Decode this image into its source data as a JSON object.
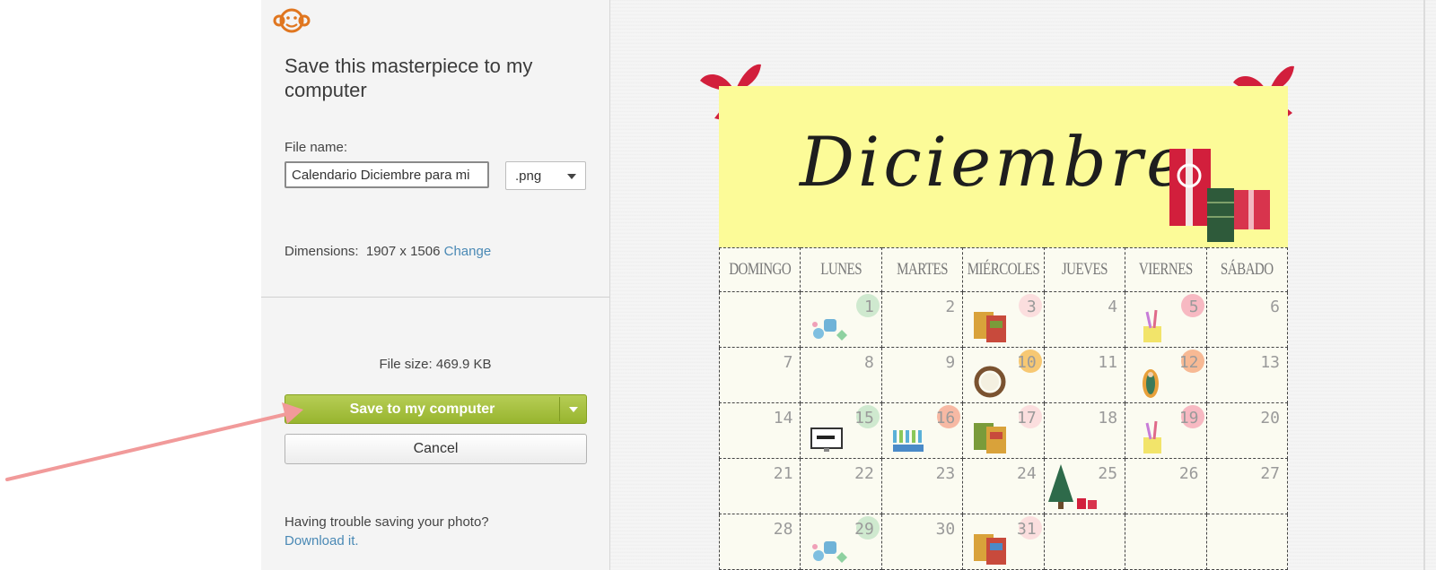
{
  "dialog": {
    "title": "Save this masterpiece to my computer",
    "file_name_label": "File name:",
    "file_name_value": "Calendario Diciembre para mi",
    "extension": ".png",
    "dimensions_label": "Dimensions:",
    "dimensions_value": "1907 x 1506",
    "change_link": "Change",
    "file_size": "File size: 469.9 KB",
    "save_button": "Save to my computer",
    "cancel_button": "Cancel",
    "trouble_text": "Having trouble saving your photo?",
    "download_link": "Download it."
  },
  "calendar": {
    "month": "Diciembre",
    "weekdays": [
      "DOMINGO",
      "LUNES",
      "MARTES",
      "MIÉRCOLES",
      "JUEVES",
      "VIERNES",
      "SÁBADO"
    ],
    "weeks": [
      [
        "",
        "1",
        "2",
        "3",
        "4",
        "5",
        "6"
      ],
      [
        "7",
        "8",
        "9",
        "10",
        "11",
        "12",
        "13"
      ],
      [
        "14",
        "15",
        "16",
        "17",
        "18",
        "19",
        "20"
      ],
      [
        "21",
        "22",
        "23",
        "24",
        "25",
        "26",
        "27"
      ],
      [
        "28",
        "29",
        "30",
        "31",
        "",
        "",
        ""
      ]
    ]
  },
  "colors": {
    "accent_green": "#a4c03c",
    "link_blue": "#4a89b5",
    "header_yellow": "#fcfb98",
    "bow_red": "#d21f3c",
    "arrow_pink": "#f19a9a"
  }
}
